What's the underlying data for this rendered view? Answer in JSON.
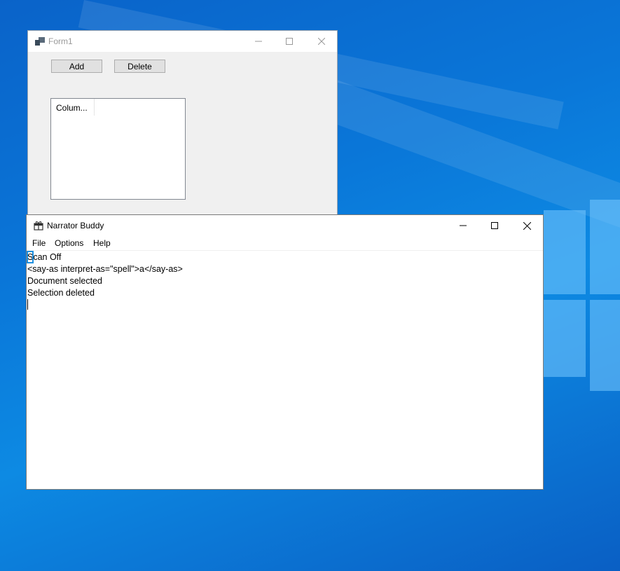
{
  "form1": {
    "title": "Form1",
    "add_label": "Add",
    "delete_label": "Delete",
    "column_header": "Colum..."
  },
  "narrator": {
    "title": "Narrator Buddy",
    "menu": [
      "File",
      "Options",
      "Help"
    ],
    "log_lines": [
      "Scan Off",
      "<say-as interpret-as=\"spell\">a</say-as>",
      "Document selected",
      "Selection deleted"
    ]
  }
}
